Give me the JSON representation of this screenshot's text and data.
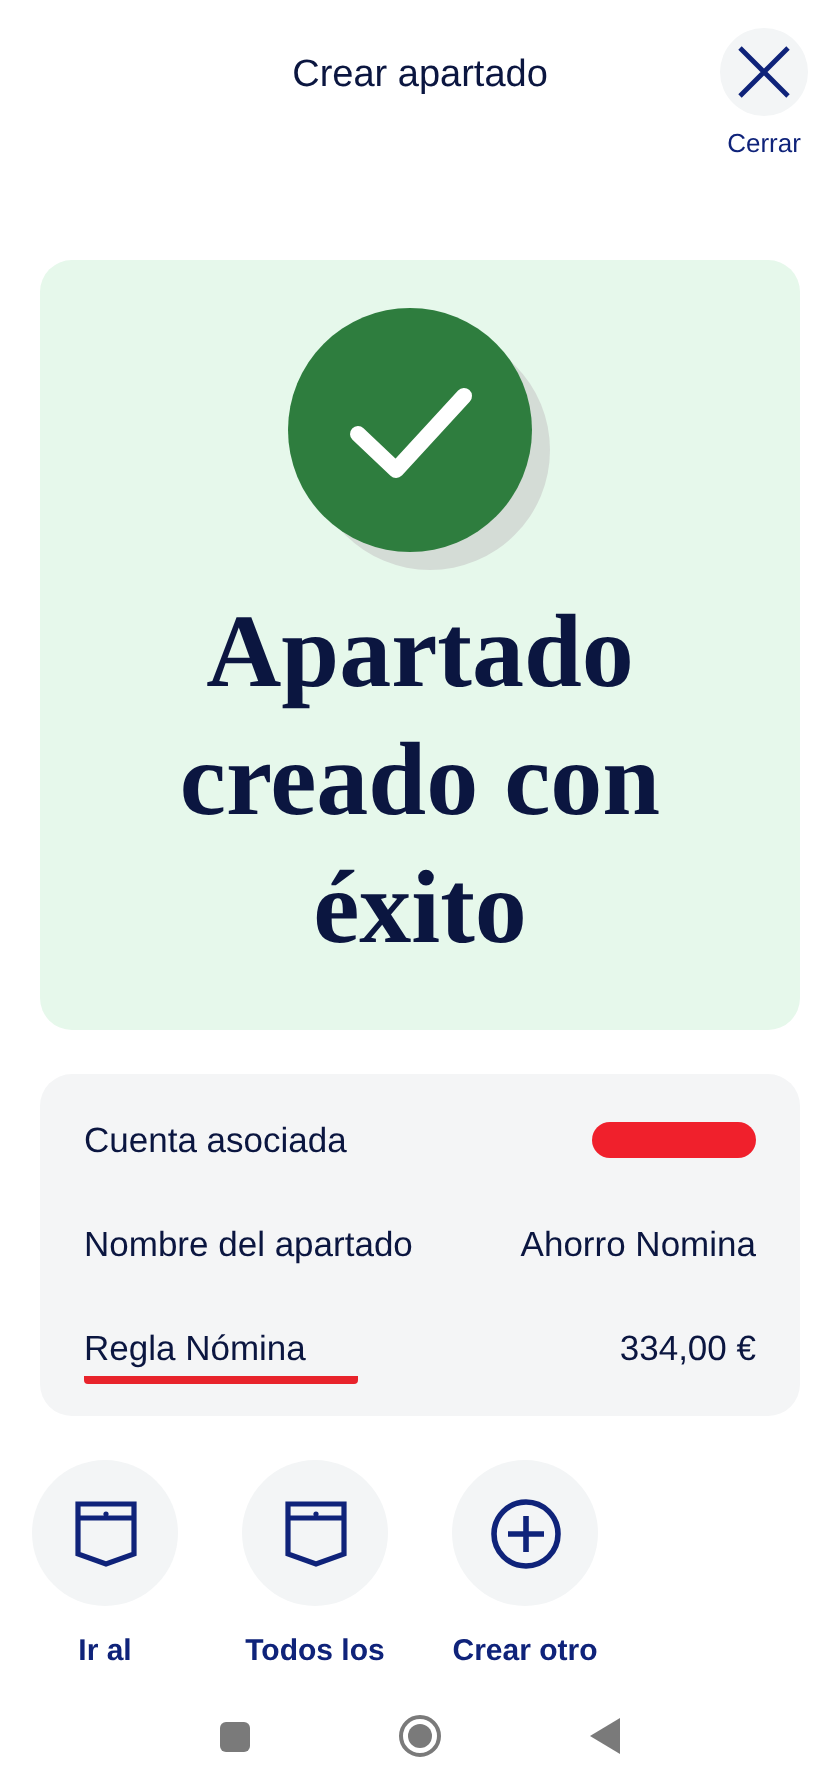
{
  "header": {
    "title": "Crear apartado",
    "close_label": "Cerrar"
  },
  "success": {
    "message": "Apartado creado con éxito"
  },
  "details": [
    {
      "label": "Cuenta asociada",
      "value_redacted": true,
      "label_underlined": false
    },
    {
      "label": "Nombre del apartado",
      "value": "Ahorro Nomina",
      "value_redacted": false,
      "label_underlined": false
    },
    {
      "label": "Regla Nómina",
      "value": "334,00 €",
      "value_redacted": false,
      "label_underlined": true
    }
  ],
  "actions": [
    {
      "kind": "pocket",
      "label": "Ir al"
    },
    {
      "kind": "pocket",
      "label": "Todos los"
    },
    {
      "kind": "plus",
      "label": "Crear otro"
    }
  ]
}
